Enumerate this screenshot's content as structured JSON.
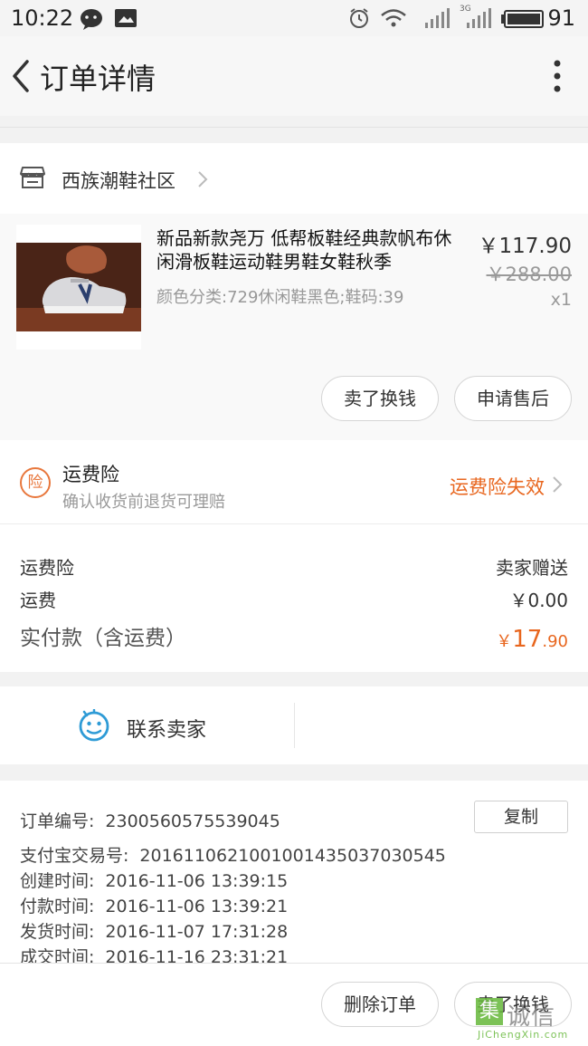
{
  "status_bar": {
    "time": "10:22",
    "network": "3G",
    "battery": "91"
  },
  "header": {
    "title": "订单详情"
  },
  "store": {
    "name": "西族潮鞋社区"
  },
  "product": {
    "name": "新品新款尧万 低帮板鞋经典款帆布休闲滑板鞋运动鞋男鞋女鞋秋季",
    "sku": "颜色分类:729休闲鞋黑色;鞋码:39",
    "price": "￥117.90",
    "original_price": "￥288.00",
    "quantity": "x1",
    "buttons": {
      "sell": "卖了换钱",
      "after_sales": "申请售后"
    }
  },
  "insurance": {
    "badge": "险",
    "title": "运费险",
    "subtitle": "确认收货前退货可理赔",
    "status": "运费险失效"
  },
  "costs": {
    "rows": [
      {
        "label": "运费险",
        "value": "卖家赠送"
      },
      {
        "label": "运费",
        "value": "￥0.00"
      }
    ],
    "total_label": "实付款（含运费）",
    "total_currency": "￥",
    "total_integer": "17",
    "total_decimal": ".90"
  },
  "contact": {
    "label": "联系卖家"
  },
  "order_info": {
    "copy_label": "复制",
    "lines": [
      {
        "key": "订单编号:",
        "value": "2300560575539045"
      },
      {
        "key": "支付宝交易号:",
        "value": "2016110621001001435037030545"
      },
      {
        "key": "创建时间:",
        "value": "2016-11-06 13:39:15"
      },
      {
        "key": "付款时间:",
        "value": "2016-11-06 13:39:21"
      },
      {
        "key": "发货时间:",
        "value": "2016-11-07 17:31:28"
      },
      {
        "key": "成交时间:",
        "value": "2016-11-16 23:31:21"
      }
    ]
  },
  "bottom_bar": {
    "delete": "删除订单",
    "sell": "卖了换钱"
  },
  "watermark": {
    "mark": "集",
    "text": "诚信",
    "url": "JiChengXin.com"
  },
  "colors": {
    "accent": "#e8661e",
    "contact_icon": "#2e9bd6",
    "watermark": "#66b83a"
  }
}
